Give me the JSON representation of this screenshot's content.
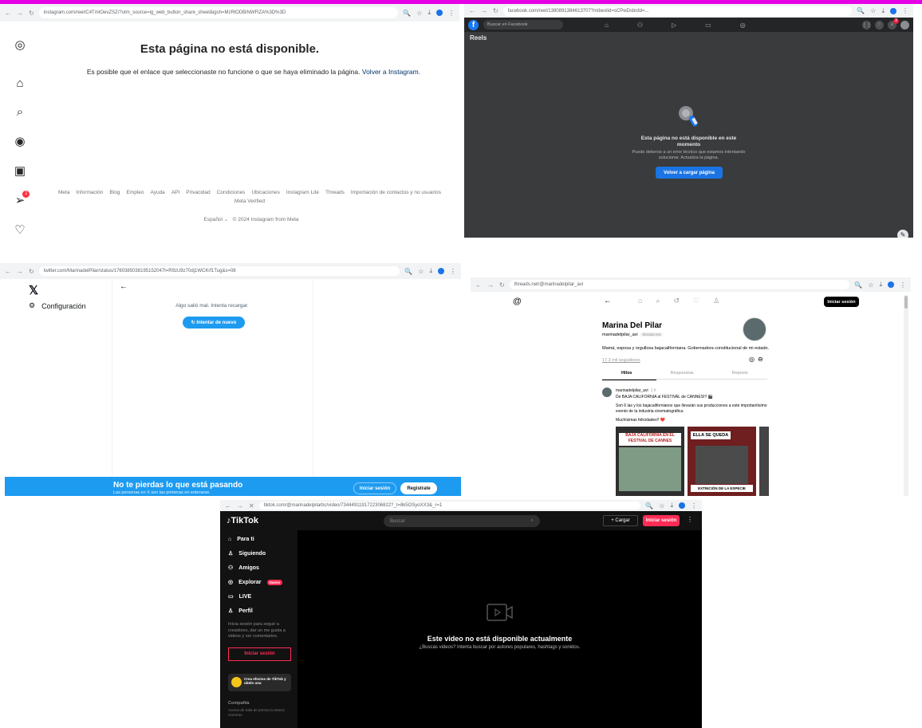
{
  "instagram": {
    "url": "instagram.com/reel/C4TmIOevZSZ/?utm_source=ig_web_button_share_sheet&igsh=MzRlODBiNWFlZA%3D%3D",
    "title": "Esta página no está disponible.",
    "message": "Es posible que el enlace que seleccionaste no funcione o que se haya eliminado la página.",
    "link": "Volver a Instagram.",
    "notification_count": "1",
    "footer_links": [
      "Meta",
      "Información",
      "Blog",
      "Empleo",
      "Ayuda",
      "API",
      "Privacidad",
      "Condiciones",
      "Ubicaciones",
      "Instagram Lite",
      "Threads",
      "Importación de contactos y no usuarios",
      "Meta Verified"
    ],
    "language": "Español ⌄",
    "copyright": "© 2024 Instagram from Meta"
  },
  "facebook": {
    "url": "facebook.com/reel/1380891384613707?mibextid=sCPwDsbrdd=...",
    "search_placeholder": "Buscar en Facebook",
    "section": "Reels",
    "error_title": "Esta página no está disponible en este momento",
    "error_sub": "Puede deberse a un error técnico que estamos intentando solucionar. Actualiza la página.",
    "reload_button": "Volver a cargar página",
    "notif_count": "3"
  },
  "x": {
    "url": "twitter.com/MarinadelPilar/status/1760385038195152047t=R9zU9z70dj1WCKrf1Tug&s=08",
    "settings_label": "Configuración",
    "error": "Algo salió mal. Intenta recargar.",
    "retry_button": "Intentar de nuevo",
    "banner_title": "No te pierdas lo que está pasando",
    "banner_sub": "Las personas en X son las primeras en enterarse.",
    "login_button": "Iniciar sesión",
    "register_button": "Registrate"
  },
  "threads": {
    "url": "threads.net/@marinadelpilar_avi",
    "login_button": "Iniciar sesión",
    "name": "Marina Del Pilar",
    "username": "marinadelpilar_avi",
    "badge": "threads.net",
    "bio": "Mamá, esposa y orgullosa bajacaliforniana. Gobernadora constitucional de mi estado.",
    "followers": "17.3 mil seguidores",
    "tabs": [
      "Hilos",
      "Respuestas",
      "Reposts"
    ],
    "post": {
      "user": "marinadelpilar_avi",
      "time": "1 h",
      "line1": "De BAJA CALIFORNIA al FESTIVAL de CANNES!!! 🎬",
      "line2": "Son 6 las y los bajacalifornianos que llevarán sus producciones a este importantísimo evento de la industria cinematográfica.",
      "line3": "Muchísimas felicidades!! ❤️",
      "img1_text": "BAJA CALIFORNIA EN EL FESTIVAL DE CANNES",
      "img2_title": "ELLA SE QUEDA",
      "img2_bottom": "EXTINCIÓN DE LA ESPECIE"
    }
  },
  "tiktok": {
    "url": "tiktok.com/@marinadelpilarbc/video/7344491191722306822?_t=8k5OSyoXX3&_r=1",
    "logo": "TikTok",
    "search_placeholder": "Buscar",
    "upload_button": "+  Cargar",
    "login_button": "Iniciar sesión",
    "nav": [
      {
        "label": "Para ti",
        "icon": "home-icon"
      },
      {
        "label": "Siguiendo",
        "icon": "user-icon"
      },
      {
        "label": "Amigos",
        "icon": "friends-icon"
      },
      {
        "label": "Explorar",
        "icon": "compass-icon"
      },
      {
        "label": "LIVE",
        "icon": "live-icon"
      },
      {
        "label": "Perfil",
        "icon": "profile-icon"
      }
    ],
    "explore_badge": "Nuevo",
    "hint": "Inicia sesión para seguir a creadores, dar un me gusta a videos y ver comentarios.",
    "side_login": "Iniciar sesión",
    "promo": "Crea efectos de TikTok y obtén una",
    "company": "Compañía",
    "company_links": "Acerca de  Sala de prensa  Contacto  Carreras",
    "error_title": "Este video no está disponible actualmente",
    "error_sub": "¿Buscas videos? Intenta buscar por autores populares, hashtags y sonidos."
  }
}
